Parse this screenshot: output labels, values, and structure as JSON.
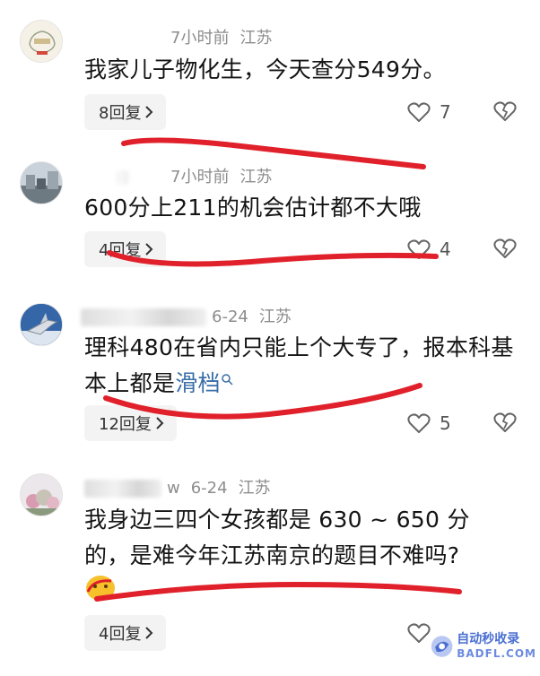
{
  "comments": [
    {
      "name": "",
      "time": "7小时前",
      "location": "江苏",
      "text": "我家儿子物化生，今天查分549分。",
      "replies": "8回复",
      "likes": "7"
    },
    {
      "name": "",
      "time": "7小时前",
      "location": "江苏",
      "text": "600分上211的机会估计都不大哦",
      "replies": "4回复",
      "likes": "4"
    },
    {
      "name": "",
      "time": "6-24",
      "location": "江苏",
      "text": "理科480在省内只能上个大专了，报本科基本上都是",
      "link": "滑档",
      "replies": "12回复",
      "likes": "5"
    },
    {
      "name": "w",
      "time": "6-24",
      "location": "江苏",
      "text": "我身边三四个女孩都是 630 ~ 650 分的，是难今年江苏南京的题目不难吗?",
      "replies": "4回复",
      "likes": ""
    }
  ],
  "icons": {
    "like": "heart-outline-icon",
    "dislike": "broken-heart-icon",
    "chevron": "chevron-right-icon",
    "search": "search-icon"
  },
  "colors": {
    "annotation_stroke": "#e0202a",
    "link": "#3a6ea8",
    "meta": "#8d8d8d"
  },
  "watermark": {
    "line1": "自动秒收录",
    "line2": "BADFL.COM"
  }
}
